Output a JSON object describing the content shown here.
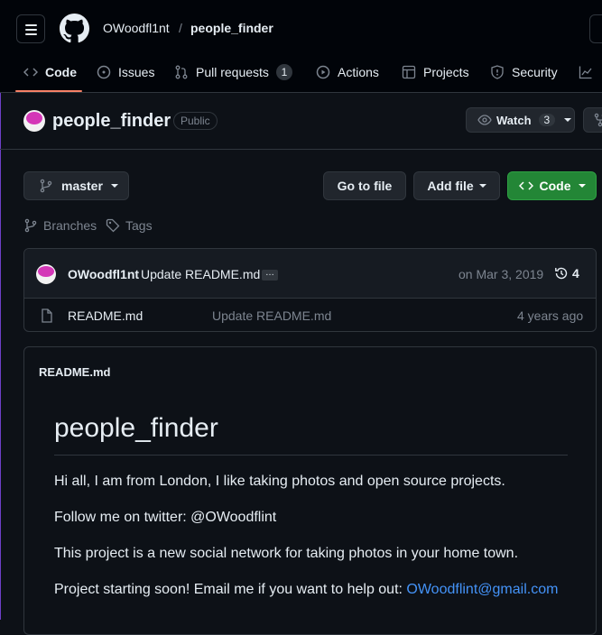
{
  "header": {
    "owner": "OWoodfl1nt",
    "separator": "/",
    "repo": "people_finder"
  },
  "tabs": [
    {
      "label": "Code",
      "icon": "code-icon",
      "active": true
    },
    {
      "label": "Issues",
      "icon": "issue-icon"
    },
    {
      "label": "Pull requests",
      "icon": "pull-request-icon",
      "count": "1"
    },
    {
      "label": "Actions",
      "icon": "play-icon"
    },
    {
      "label": "Projects",
      "icon": "table-icon"
    },
    {
      "label": "Security",
      "icon": "shield-icon"
    },
    {
      "label": "",
      "icon": "graph-icon"
    }
  ],
  "repo": {
    "title": "people_finder",
    "visibility": "Public",
    "watch_label": "Watch",
    "watch_count": "3"
  },
  "toolbar": {
    "branch": "master",
    "go_to_file": "Go to file",
    "add_file": "Add file",
    "code": "Code",
    "branches": "Branches",
    "tags": "Tags"
  },
  "commit": {
    "author": "OWoodfl1nt",
    "message": "Update README.md",
    "ellipsis": "…",
    "date": "on Mar 3, 2019",
    "history_count": "4"
  },
  "files": [
    {
      "name": "README.md",
      "message": "Update README.md",
      "age": "4 years ago",
      "icon": "file-icon"
    }
  ],
  "readme": {
    "filename": "README.md",
    "heading": "people_finder",
    "p1": "Hi all, I am from London, I like taking photos and open source projects.",
    "p2": "Follow me on twitter: @OWoodflint",
    "p3": "This project is a new social network for taking photos in your home town.",
    "p4_text": "Project starting soon! Email me if you want to help out: ",
    "p4_link": "OWoodflint@gmail.com"
  },
  "colors": {
    "accent_underline": "#f78166",
    "code_button": "#238636",
    "link": "#4493f8",
    "avatar": "#d437b7"
  }
}
